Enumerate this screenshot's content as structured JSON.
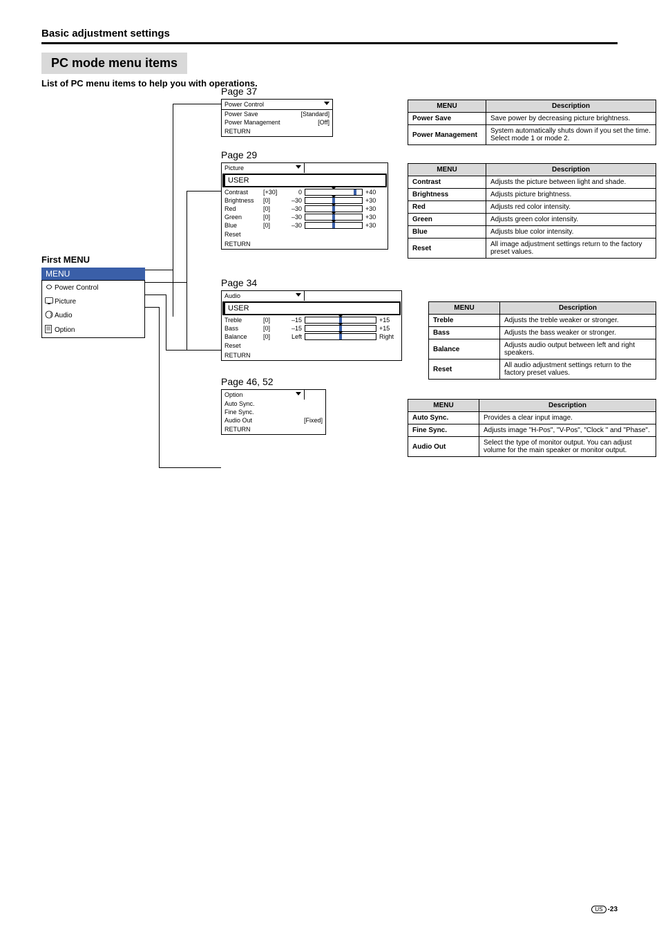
{
  "header": {
    "section": "Basic adjustment settings",
    "mode_title": "PC mode menu items",
    "subtitle": "List of PC menu items to help you with operations."
  },
  "first_menu": {
    "label": "First MENU",
    "bar": "MENU",
    "items": [
      "Power Control",
      "Picture",
      "Audio",
      "Option"
    ]
  },
  "panels": {
    "power": {
      "page": "Page 37",
      "title": "Power Control",
      "rows": [
        {
          "name": "Power Save",
          "value": "[Standard]"
        },
        {
          "name": "Power Management",
          "value": "[Off]"
        },
        {
          "name": "RETURN",
          "value": ""
        }
      ]
    },
    "picture": {
      "page": "Page 29",
      "title": "Picture",
      "user": "USER",
      "sliders": [
        {
          "name": "Contrast",
          "val": "[+30]",
          "lo": "0",
          "hi": "+40",
          "high": true
        },
        {
          "name": "Brightness",
          "val": "[0]",
          "lo": "–30",
          "hi": "+30",
          "high": false
        },
        {
          "name": "Red",
          "val": "[0]",
          "lo": "–30",
          "hi": "+30",
          "high": false
        },
        {
          "name": "Green",
          "val": "[0]",
          "lo": "–30",
          "hi": "+30",
          "high": false
        },
        {
          "name": "Blue",
          "val": "[0]",
          "lo": "–30",
          "hi": "+30",
          "high": false
        }
      ],
      "tail": [
        "Reset",
        "RETURN"
      ]
    },
    "audio": {
      "page": "Page 34",
      "title": "Audio",
      "user": "USER",
      "sliders": [
        {
          "name": "Treble",
          "val": "[0]",
          "lo": "–15",
          "hi": "+15"
        },
        {
          "name": "Bass",
          "val": "[0]",
          "lo": "–15",
          "hi": "+15"
        },
        {
          "name": "Balance",
          "val": "[0]",
          "lo": "Left",
          "hi": "Right"
        }
      ],
      "tail": [
        "Reset",
        "RETURN"
      ]
    },
    "option": {
      "page": "Page 46, 52",
      "title": "Option",
      "rows": [
        {
          "name": "Auto Sync.",
          "value": ""
        },
        {
          "name": "Fine Sync.",
          "value": ""
        },
        {
          "name": "Audio Out",
          "value": "[Fixed]"
        },
        {
          "name": "RETURN",
          "value": ""
        }
      ]
    }
  },
  "tables": {
    "headers": {
      "menu": "MENU",
      "desc": "Description"
    },
    "power": [
      {
        "k": "Power Save",
        "d": "Save power by decreasing picture brightness."
      },
      {
        "k": "Power Management",
        "d": "System automatically shuts down if you set the time. Select mode 1 or mode 2."
      }
    ],
    "picture": [
      {
        "k": "Contrast",
        "d": "Adjusts the picture between light and shade."
      },
      {
        "k": "Brightness",
        "d": "Adjusts picture brightness."
      },
      {
        "k": "Red",
        "d": "Adjusts red color intensity."
      },
      {
        "k": "Green",
        "d": "Adjusts green color intensity."
      },
      {
        "k": "Blue",
        "d": "Adjusts blue color intensity."
      },
      {
        "k": "Reset",
        "d": "All image adjustment settings return to the factory preset values."
      }
    ],
    "audio": [
      {
        "k": "Treble",
        "d": "Adjusts the treble weaker or stronger."
      },
      {
        "k": "Bass",
        "d": "Adjusts the bass weaker or stronger."
      },
      {
        "k": "Balance",
        "d": "Adjusts audio output between left and right speakers."
      },
      {
        "k": "Reset",
        "d": "All audio adjustment settings return to the factory preset values."
      }
    ],
    "option": [
      {
        "k": "Auto Sync.",
        "d": "Provides a clear input image."
      },
      {
        "k": "Fine Sync.",
        "d": "Adjusts image \"H-Pos\", \"V-Pos\", \"Clock \" and \"Phase\"."
      },
      {
        "k": "Audio Out",
        "d": "Select the type of monitor output. You can adjust volume for the main speaker or monitor output."
      }
    ]
  },
  "footer": {
    "region": "US",
    "page": "-23"
  }
}
